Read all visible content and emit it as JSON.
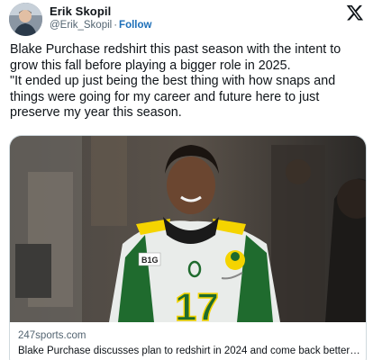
{
  "author": {
    "name": "Erik Skopil",
    "handle": "@Erik_Skopil",
    "separator": "·",
    "follow_label": "Follow"
  },
  "icons": {
    "platform": "x-logo-icon",
    "avatar": "avatar-photo"
  },
  "tweet": {
    "paragraph1": "Blake Purchase redshirt this past season with the intent to grow this fall before playing a bigger role in 2025.",
    "paragraph2": "\"It ended up just being the best thing with how snaps and things were going for my career and future here to just preserve my year this season."
  },
  "card": {
    "domain": "247sports.com",
    "title": "Blake Purchase discusses plan to redshirt in 2024 and come back better ...",
    "image_text": {
      "jersey_number": "17",
      "patch": "B1G"
    }
  },
  "colors": {
    "follow": "#1d6fb8",
    "secondary_text": "#536471",
    "card_border": "#cfd9de",
    "jersey_green": "#1f6b2e",
    "jersey_yellow": "#f5d400"
  }
}
